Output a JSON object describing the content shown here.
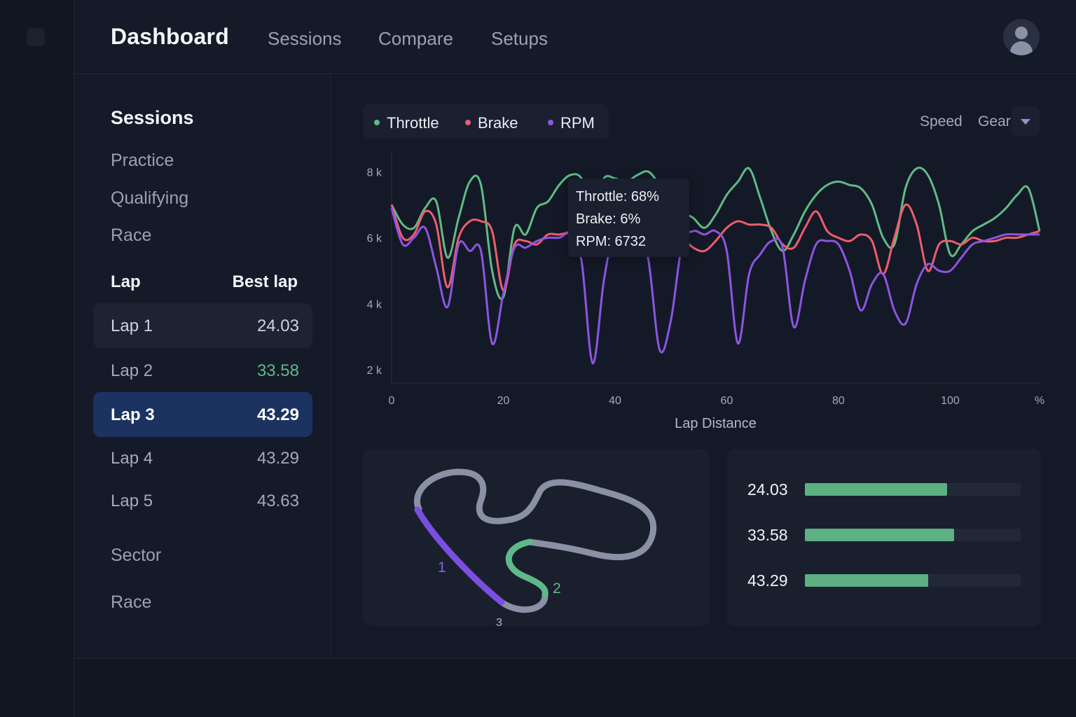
{
  "header": {
    "title": "Dashboard",
    "nav": [
      "Sessions",
      "Compare",
      "Setups"
    ]
  },
  "sidebar": {
    "sessions_title": "Sessions",
    "sessions": [
      "Practice",
      "Qualifying",
      "Race"
    ],
    "lap_header": "Lap",
    "best_header": "Best lap",
    "laps": [
      {
        "name": "Lap 1",
        "time": "24.03"
      },
      {
        "name": "Lap 2",
        "time": "33.58"
      },
      {
        "name": "Lap 3",
        "time": "43.29"
      },
      {
        "name": "Lap 4",
        "time": "43.29"
      },
      {
        "name": "Lap 5",
        "time": "43.63"
      }
    ],
    "sector_label": "Sector",
    "race_label": "Race"
  },
  "legend": {
    "throttle": "Throttle",
    "brake": "Brake",
    "rpm": "RPM"
  },
  "selectors": {
    "speed": "Speed",
    "gear": "Gear"
  },
  "tooltip": {
    "throttle": "Throttle: 68%",
    "brake": "Brake: 6%",
    "rpm": "RPM: 6732"
  },
  "track": {
    "sector_labels": [
      "1",
      "2",
      "3"
    ]
  },
  "lap_bars": [
    {
      "label": "24.03",
      "fraction": 0.66
    },
    {
      "label": "33.58",
      "fraction": 0.69
    },
    {
      "label": "43.29",
      "fraction": 0.57
    }
  ],
  "colors": {
    "throttle": "#5fbb86",
    "brake": "#ee5d6c",
    "rpm": "#8c55e0",
    "accent": "#1c3260",
    "best": "#5fb88a"
  },
  "chart_data": {
    "type": "line",
    "xlabel": "Lap Distance",
    "x_tick_labels": [
      "0",
      "20",
      "40",
      "60",
      "80",
      "100",
      "%"
    ],
    "y_tick_labels": [
      "8 k",
      "6 k",
      "4 k",
      "2 k"
    ],
    "xlim": [
      0,
      116
    ],
    "ylim": [
      1600,
      8600
    ],
    "x": [
      0,
      2,
      4,
      6,
      8,
      10,
      12,
      14,
      16,
      18,
      20,
      22,
      24,
      26,
      28,
      30,
      32,
      34,
      36,
      38,
      40,
      42,
      44,
      46,
      48,
      50,
      52,
      54,
      56,
      58,
      60,
      62,
      64,
      66,
      68,
      70,
      72,
      74,
      76,
      78,
      80,
      82,
      84,
      86,
      88,
      90,
      92,
      94,
      96,
      98,
      100,
      102,
      104,
      106,
      108,
      110,
      112,
      114,
      116
    ],
    "series": [
      {
        "name": "Throttle",
        "values": [
          7000,
          6400,
          6300,
          6900,
          7100,
          5400,
          6600,
          7700,
          7600,
          5000,
          4200,
          6300,
          6100,
          6900,
          7100,
          7600,
          7900,
          7800,
          6900,
          7800,
          7800,
          7700,
          7900,
          8000,
          7600,
          7200,
          6800,
          6600,
          6300,
          6700,
          7300,
          7700,
          8100,
          7200,
          6200,
          5600,
          6100,
          6800,
          7300,
          7600,
          7700,
          7600,
          7500,
          7000,
          6000,
          5800,
          7500,
          8100,
          7900,
          7000,
          5500,
          5800,
          6200,
          6400,
          6600,
          6900,
          7300,
          7500,
          6200
        ]
      },
      {
        "name": "Brake",
        "values": [
          7000,
          6000,
          6100,
          6800,
          6400,
          4500,
          6000,
          6500,
          6500,
          6200,
          4400,
          5800,
          5900,
          5800,
          6100,
          6100,
          6200,
          6500,
          6600,
          6300,
          6100,
          6300,
          6400,
          6500,
          6400,
          6200,
          6000,
          5700,
          5600,
          5900,
          6300,
          6500,
          6400,
          6400,
          6300,
          5800,
          5700,
          6300,
          6800,
          6200,
          6000,
          5900,
          6100,
          5900,
          4900,
          6000,
          7000,
          6400,
          5000,
          5800,
          5900,
          5800,
          6000,
          5900,
          5900,
          6000,
          6000,
          6100,
          6200
        ]
      },
      {
        "name": "RPM",
        "values": [
          6900,
          5800,
          6000,
          6300,
          5100,
          3900,
          5800,
          5600,
          5600,
          2800,
          4300,
          5700,
          5700,
          5900,
          6000,
          6000,
          6100,
          5300,
          2200,
          4700,
          6300,
          6300,
          6400,
          5300,
          2600,
          3500,
          5800,
          6200,
          6100,
          6200,
          5600,
          2800,
          4900,
          5500,
          5900,
          5700,
          3300,
          4700,
          5800,
          5900,
          5800,
          5000,
          3800,
          4600,
          4900,
          3800,
          3400,
          4600,
          5200,
          5000,
          5000,
          5400,
          5800,
          5900,
          6000,
          6100,
          6100,
          6100,
          6100
        ]
      }
    ]
  }
}
